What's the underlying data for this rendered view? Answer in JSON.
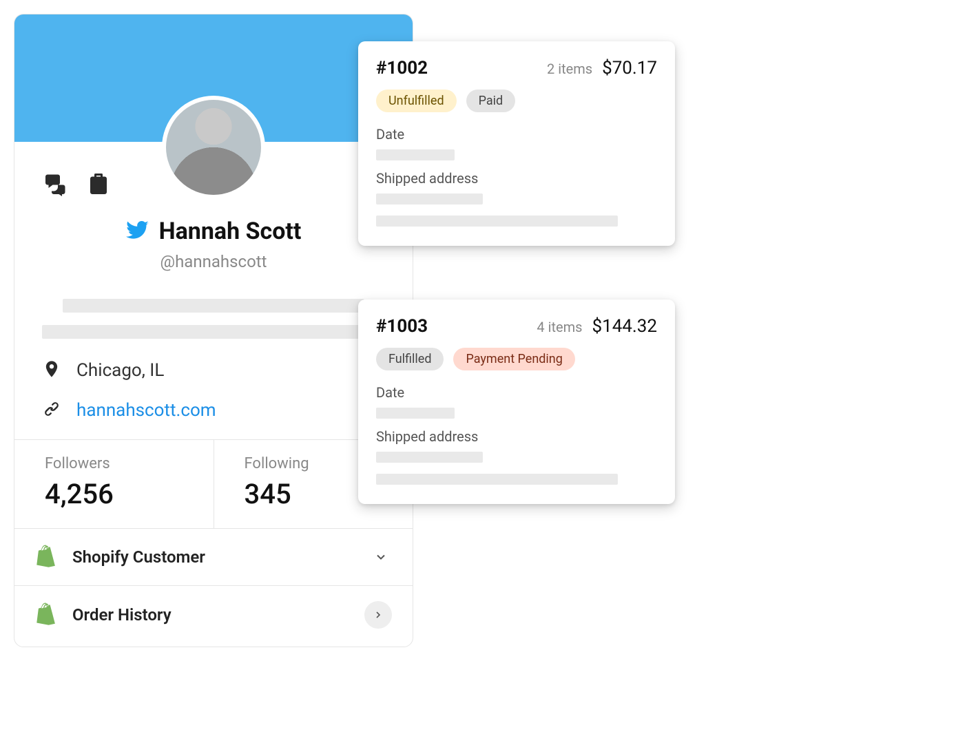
{
  "profile": {
    "display_name": "Hannah Scott",
    "handle": "@hannahscott",
    "location": "Chicago, IL",
    "website": "hannahscott.com",
    "followers_label": "Followers",
    "followers_count": "4,256",
    "following_label": "Following",
    "following_count": "345"
  },
  "sections": {
    "customer": "Shopify Customer",
    "orders": "Order History"
  },
  "orders": [
    {
      "id": "#1002",
      "items": "2 items",
      "total": "$70.17",
      "fulfillment": "Unfulfilled",
      "fulfillment_style": "yellow",
      "payment": "Paid",
      "payment_style": "gray"
    },
    {
      "id": "#1003",
      "items": "4 items",
      "total": "$144.32",
      "fulfillment": "Fulfilled",
      "fulfillment_style": "gray",
      "payment": "Payment Pending",
      "payment_style": "peach"
    }
  ],
  "labels": {
    "date": "Date",
    "shipped_address": "Shipped address"
  }
}
